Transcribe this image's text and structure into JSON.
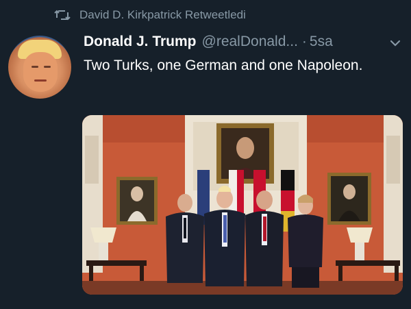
{
  "retweet": {
    "icon": "retweet-icon",
    "text": "David D. Kirkpatrick Retweetledi"
  },
  "tweet": {
    "author_name": "Donald J. Trump",
    "handle": "@realDonald...",
    "separator": "·",
    "time": "5sa",
    "text": "Two Turks, one German and one Napoleon.",
    "avatar_icon": "profile-avatar",
    "menu_icon": "chevron-down-icon"
  },
  "colors": {
    "background": "#16202a",
    "secondary_text": "#8899a6",
    "primary_text": "#ffffff",
    "wall": "#c95c3a"
  },
  "photo": {
    "description_icon": "photo-image"
  }
}
